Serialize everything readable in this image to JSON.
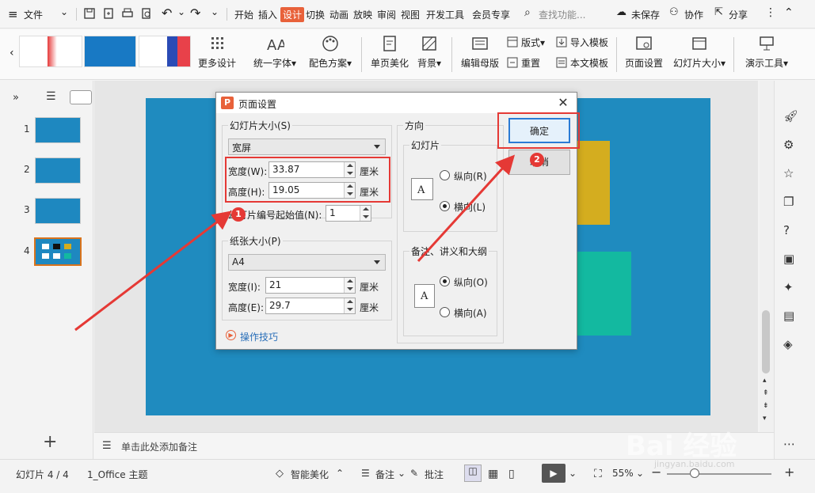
{
  "menubar": {
    "file": "文件",
    "tabs": [
      "开始",
      "插入",
      "设计",
      "切换",
      "动画",
      "放映",
      "审阅",
      "视图",
      "开发工具",
      "会员专享"
    ],
    "active_tab": "设计",
    "search": "查找功能...",
    "unsaved": "未保存",
    "collab": "协作",
    "share": "分享"
  },
  "ribbon": {
    "more_design": "更多设计",
    "unify_font": "统一字体",
    "color_scheme": "配色方案",
    "single_page": "单页美化",
    "background": "背景",
    "edit_master": "编辑母版",
    "layout": "版式",
    "reset": "重置",
    "import_template": "导入模板",
    "text_template": "本文模板",
    "page_setup": "页面设置",
    "slide_size": "幻灯片大小",
    "presentation_tools": "演示工具"
  },
  "slides": [
    "1",
    "2",
    "3",
    "4"
  ],
  "notes_placeholder": "单击此处添加备注",
  "status": {
    "slide_counter": "幻灯片 4 / 4",
    "theme": "1_Office 主题",
    "smart_beautify": "智能美化",
    "notes": "备注",
    "comments": "批注",
    "zoom": "55%"
  },
  "dialog": {
    "title": "页面设置",
    "slide_size_group": "幻灯片大小(S)",
    "slide_size_value": "宽屏",
    "width_label": "宽度(W):",
    "width_value": "33.87",
    "height_label": "高度(H):",
    "height_value": "19.05",
    "unit": "厘米",
    "start_number_label": "幻灯片编号起始值(N):",
    "start_number_value": "1",
    "paper_group": "纸张大小(P)",
    "paper_value": "A4",
    "paper_width_label": "宽度(I):",
    "paper_width_value": "21",
    "paper_height_label": "高度(E):",
    "paper_height_value": "29.7",
    "tips": "操作技巧",
    "orientation_group": "方向",
    "slides_sub": "幻灯片",
    "portrait_r": "纵向(R)",
    "landscape_l": "横向(L)",
    "notes_sub": "备注、讲义和大纲",
    "portrait_o": "纵向(O)",
    "landscape_a": "横向(A)",
    "ok": "确定",
    "cancel": "取消"
  },
  "annotations": {
    "badge1": "1",
    "badge2": "2"
  },
  "watermark": "Bai 经验",
  "watermark_url": "jingyan.baidu.com"
}
